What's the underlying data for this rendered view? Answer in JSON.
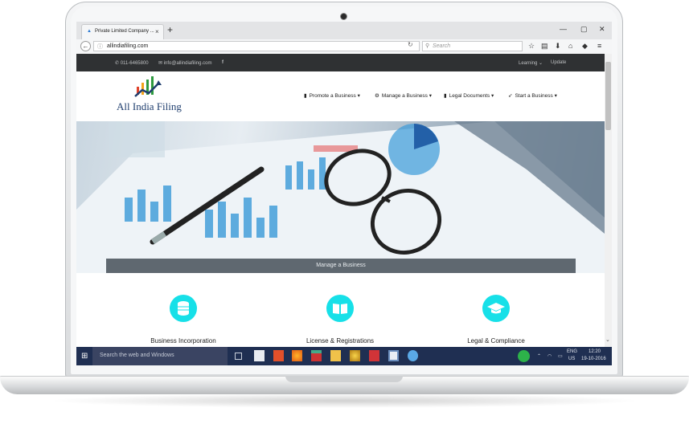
{
  "browser": {
    "tab_title": "Private Limited Company ...",
    "tab_close": "×",
    "new_tab": "+",
    "url": "allindiafiling.com",
    "search_placeholder": "Search",
    "icons": [
      "back-arrow-icon",
      "info-icon",
      "reload-icon",
      "search-icon",
      "star-icon",
      "reading-list-icon",
      "download-icon",
      "home-icon",
      "pocket-icon",
      "hamburger-menu-icon"
    ]
  },
  "topbar": {
    "phone": "011-6465800",
    "email": "info@allindiafiling.com",
    "facebook": "f",
    "links": [
      "Learning",
      "Update"
    ]
  },
  "header": {
    "logo_text": "All India Filing",
    "menu": [
      {
        "label": "Promote a Business",
        "icon": "bar-chart-icon"
      },
      {
        "label": "Manage a Business",
        "icon": "gear-icon"
      },
      {
        "label": "Legal Documents",
        "icon": "document-icon"
      },
      {
        "label": "Start a Business",
        "icon": "rocket-icon"
      }
    ]
  },
  "hero": {
    "caption": "Manage a Business"
  },
  "features": [
    {
      "title": "Business Incorporation",
      "icon": "database-icon"
    },
    {
      "title": "License & Registrations",
      "icon": "book-icon"
    },
    {
      "title": "Legal & Compliance",
      "icon": "graduation-cap-icon"
    }
  ],
  "taskbar": {
    "search_text": "Search the web and Windows",
    "lang_top": "ENG",
    "lang_bottom": "US",
    "time": "12:20",
    "date": "19-10-2016"
  },
  "colors": {
    "accent_cyan": "#17e0e8",
    "topbar": "#2f3133",
    "taskbar": "#1f2f52",
    "logo_blue": "#1f3e6e"
  }
}
